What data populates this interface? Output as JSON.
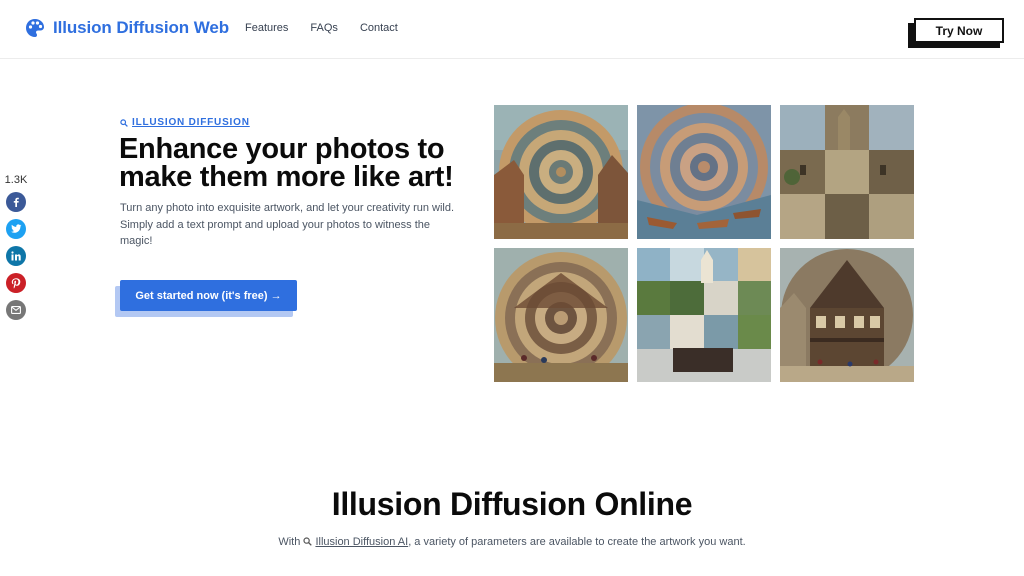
{
  "header": {
    "brand": "Illusion Diffusion Web",
    "nav": [
      {
        "label": "Features"
      },
      {
        "label": "FAQs"
      },
      {
        "label": "Contact"
      }
    ],
    "try_now": "Try Now"
  },
  "share": {
    "count": "1.3K",
    "buttons": [
      "facebook-icon",
      "twitter-icon",
      "linkedin-icon",
      "pinterest-icon",
      "email-icon"
    ]
  },
  "hero": {
    "eyebrow": "ILLUSION DIFFUSION",
    "title_line1": "Enhance your photos to",
    "title_line2": "make them more like art!",
    "description": "Turn any photo into exquisite artwork, and let your creativity run wild. Simply add a text prompt and upload your photos to witness the magic!",
    "cta": "Get started now (it's free) →"
  },
  "gallery": {
    "images": [
      "spiral-village-image",
      "spiral-canal-image",
      "checker-castle-image",
      "spiral-house-image",
      "checker-church-image",
      "circle-townhouse-image"
    ]
  },
  "section": {
    "title": "Illusion Diffusion Online",
    "desc_prefix": "With",
    "desc_link": "Illusion Diffusion AI",
    "desc_suffix": ", a variety of parameters are available to create the artwork you want."
  },
  "colors": {
    "accent": "#2f6fdf",
    "text_dark": "#0b0b0b",
    "text_muted": "#4b5563"
  }
}
